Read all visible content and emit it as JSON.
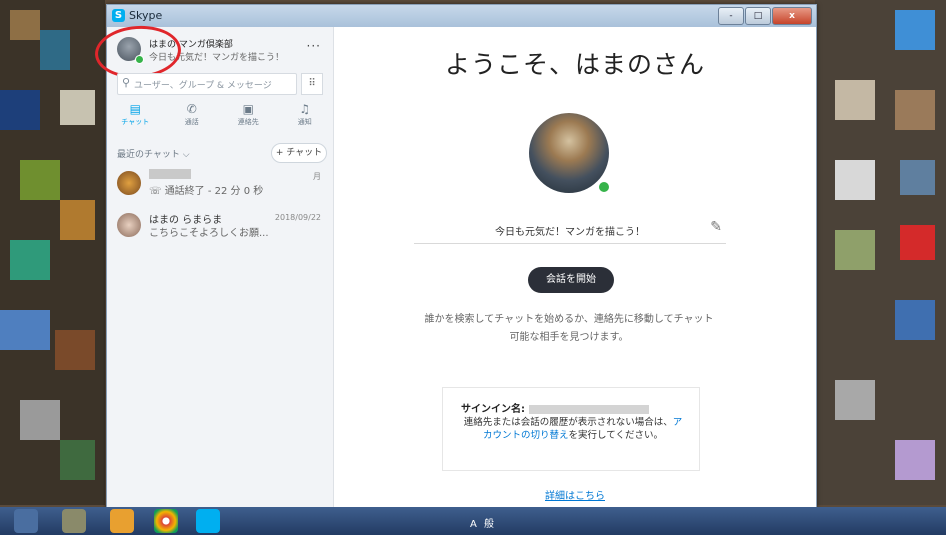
{
  "window": {
    "app_title": "Skype",
    "close_label": "x",
    "minimize_label": "-",
    "maximize_label": "□"
  },
  "profile": {
    "name": "はまの マンガ倶楽部",
    "mood": "今日も元気だ！マンガを描こう！",
    "more_label": "···"
  },
  "search": {
    "placeholder": "ユーザー、グループ & メッセージ",
    "dialpad_icon": "dialpad-icon"
  },
  "nav_tabs": [
    {
      "label": "チャット",
      "icon": "chat-icon",
      "active": true
    },
    {
      "label": "通話",
      "icon": "phone-icon",
      "active": false
    },
    {
      "label": "連絡先",
      "icon": "contacts-icon",
      "active": false
    },
    {
      "label": "通知",
      "icon": "bell-icon",
      "active": false
    }
  ],
  "recent": {
    "header": "最近のチャット ⌵",
    "new_chat_label": "+ チャット"
  },
  "chats": [
    {
      "name": "",
      "subtitle": "通話終了 - 22 分 0 秒",
      "date": "月"
    },
    {
      "name": "はまの らまらま",
      "subtitle": "こちらこそよろしくお願...",
      "date": "2018/09/22"
    }
  ],
  "main": {
    "welcome": "ようこそ、はまのさん",
    "mood": "今日も元気だ！マンガを描こう！",
    "start_button": "会話を開始",
    "description": "誰かを検索してチャットを始めるか、連絡先に移動してチャット可能な相手を見つけます。",
    "signin_label": "サインイン名:",
    "signin_text_1": "連絡先または会話の履歴が表示されない場合は、",
    "signin_link": "アカウントの切り替え",
    "signin_text_2": "を実行してください。",
    "details_link": "詳細はこちら"
  },
  "colors": {
    "accent": "#00a3e8",
    "online": "#36b34a",
    "annotation": "#e0262b",
    "button_dark": "#2b2f38"
  },
  "taskbar": {
    "tray_text": "A 般"
  }
}
